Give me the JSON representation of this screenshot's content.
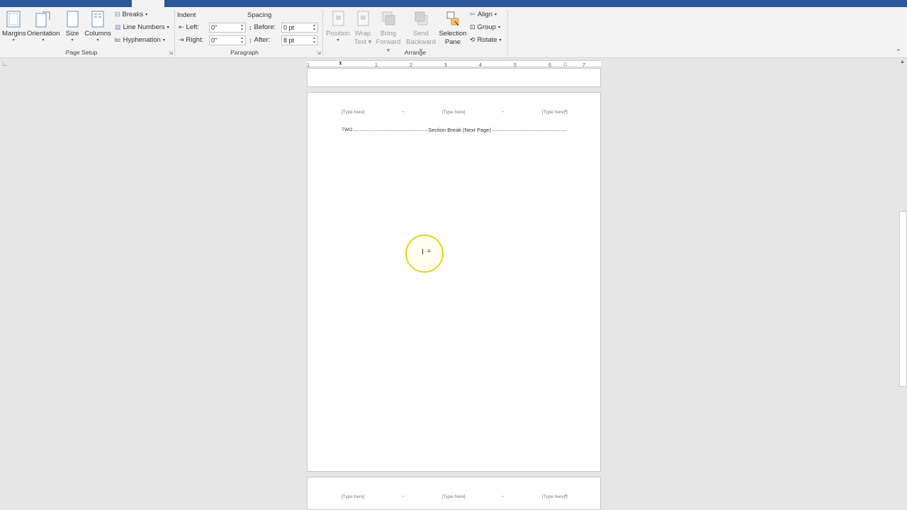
{
  "ribbon": {
    "page_setup": {
      "margins": "Margins",
      "orientation": "Orientation",
      "size": "Size",
      "columns": "Columns",
      "breaks": "Breaks",
      "line_numbers": "Line Numbers",
      "hyphenation": "Hyphenation",
      "group_label": "Page Setup"
    },
    "paragraph": {
      "indent_label": "Indent",
      "spacing_label": "Spacing",
      "left_label": "Left:",
      "left_value": "0\"",
      "right_label": "Right:",
      "right_value": "0\"",
      "before_label": "Before:",
      "before_value": "0 pt",
      "after_label": "After:",
      "after_value": "8 pt",
      "group_label": "Paragraph"
    },
    "arrange": {
      "position": "Position",
      "wrap_text_1": "Wrap",
      "wrap_text_2": "Text",
      "bring_forward_1": "Bring",
      "bring_forward_2": "Forward",
      "send_backward_1": "Send",
      "send_backward_2": "Backward",
      "selection_pane_1": "Selection",
      "selection_pane_2": "Pane",
      "align": "Align",
      "group": "Group",
      "rotate": "Rotate",
      "group_label": "Arrange"
    }
  },
  "ruler": {
    "ticks": [
      "1",
      "1",
      "2",
      "3",
      "4",
      "5",
      "6",
      "7"
    ]
  },
  "document": {
    "header_left": "[Type here]",
    "header_center": "[Type here]",
    "header_right": "[Type here]¶",
    "section_text": "TWO",
    "section_break": "Section Break (Next Page)",
    "header2_left": "[Type here]",
    "header2_center": "[Type here]",
    "header2_right": "[Type here]¶",
    "arrow": "→"
  },
  "colors": {
    "title_bar": "#2b579a",
    "ribbon_bg": "#f3f3f3",
    "workspace_bg": "#e6e6e6",
    "cursor_highlight": "#e3d41f"
  }
}
